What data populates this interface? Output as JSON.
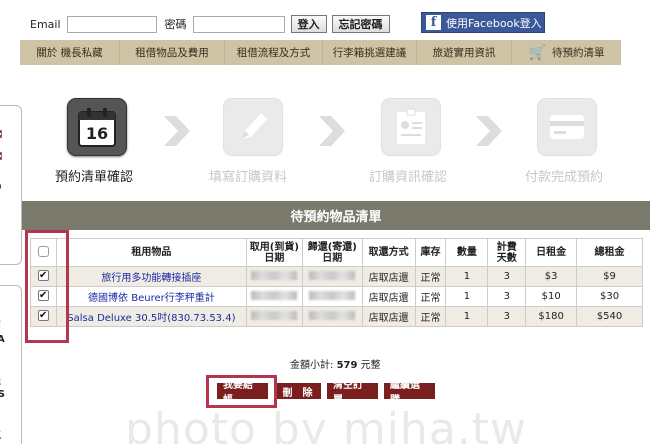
{
  "login": {
    "email_label": "Email",
    "password_label": "密碼",
    "login_button": "登入",
    "forgot_button": "忘記密碼",
    "facebook_button": "使用Facebook登入"
  },
  "menu": {
    "items": [
      "關於 機長私藏",
      "租借物品及費用",
      "租借流程及方式",
      "行李箱挑選建議",
      "旅遊實用資訊"
    ],
    "cart_label": "待預約清單"
  },
  "sidebar": {
    "texts": [
      "箱",
      "VA",
      "機",
      "AS",
      "航",
      "D"
    ]
  },
  "steps": [
    {
      "label": "預約清單確認",
      "day": "16",
      "active": true
    },
    {
      "label": "填寫訂購資料",
      "active": false
    },
    {
      "label": "訂購資訊確認",
      "active": false
    },
    {
      "label": "付款完成預約",
      "active": false
    }
  ],
  "section_title": "待預約物品清單",
  "table": {
    "headers": [
      "租用物品",
      "取用(到貨)\n日期",
      "歸還(寄還)\n日期",
      "取還方式",
      "庫存",
      "數量",
      "計費\n天數",
      "日租金",
      "總租金"
    ],
    "rows": [
      {
        "item": "旅行用多功能轉接插座",
        "method": "店取店還",
        "stock": "正常",
        "qty": "1",
        "days": "3",
        "daily": "$3",
        "total": "$9"
      },
      {
        "item": "德國博依 Beurer行李秤重計",
        "method": "店取店還",
        "stock": "正常",
        "qty": "1",
        "days": "3",
        "daily": "$10",
        "total": "$30"
      },
      {
        "item": "Salsa Deluxe 30.5吋(830.73.53.4)",
        "method": "店取店還",
        "stock": "正常",
        "qty": "1",
        "days": "3",
        "daily": "$180",
        "total": "$540"
      }
    ]
  },
  "subtotal": {
    "label": "金額小計:",
    "value": "579",
    "unit": "元整"
  },
  "actions": [
    "我要結帳",
    "刪　除",
    "清空訂單",
    "繼續選購"
  ],
  "watermark": "photo by miha.tw"
}
